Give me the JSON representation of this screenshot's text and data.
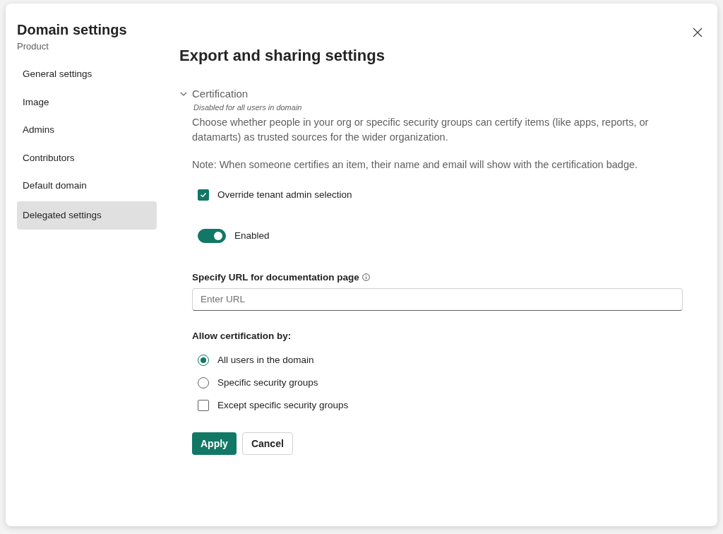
{
  "dialog": {
    "title": "Domain settings",
    "subtitle": "Product"
  },
  "sidebar": {
    "items": [
      {
        "label": "General settings",
        "selected": false
      },
      {
        "label": "Image",
        "selected": false
      },
      {
        "label": "Admins",
        "selected": false
      },
      {
        "label": "Contributors",
        "selected": false
      },
      {
        "label": "Default domain",
        "selected": false
      },
      {
        "label": "Delegated settings",
        "selected": true
      }
    ]
  },
  "main": {
    "heading": "Export and sharing settings",
    "section": {
      "title": "Certification",
      "expanded": true,
      "status": "Disabled for all users in domain",
      "description": "Choose whether people in your org or specific security groups can certify items (like apps, reports, or datamarts) as trusted sources for the wider organization.",
      "note": "Note: When someone certifies an item, their name and email will show with the certification badge.",
      "override": {
        "label": "Override tenant admin selection",
        "checked": true
      },
      "toggle": {
        "label": "Enabled",
        "on": true
      },
      "url_field": {
        "label": "Specify URL for documentation page",
        "placeholder": "Enter URL"
      },
      "allow_label": "Allow certification by:",
      "options": [
        {
          "kind": "radio",
          "label": "All users in the domain",
          "selected": true
        },
        {
          "kind": "radio",
          "label": "Specific security groups",
          "selected": false
        },
        {
          "kind": "checkbox",
          "label": "Except specific security groups",
          "checked": false
        }
      ]
    },
    "buttons": [
      {
        "label": "Apply",
        "kind": "primary"
      },
      {
        "label": "Cancel",
        "kind": "secondary"
      }
    ]
  }
}
